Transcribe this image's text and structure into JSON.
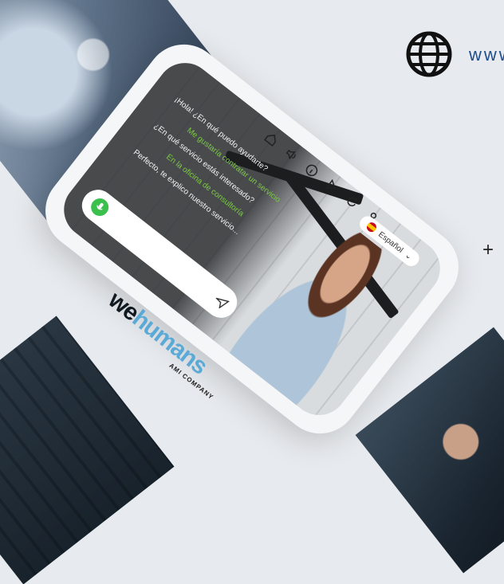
{
  "header": {
    "url": "www"
  },
  "chat": {
    "messages": [
      {
        "role": "bot",
        "text": "¡Hola! ¿En qué puedo ayudarte?"
      },
      {
        "role": "user",
        "text": "Me gustaría contratar un servicio"
      },
      {
        "role": "bot",
        "text": "¿En qué servicio estás interesado?"
      },
      {
        "role": "user",
        "text": "En la oficina de consultoría"
      },
      {
        "role": "bot",
        "text": "Perfecto, te explico nuestro servicio..."
      }
    ]
  },
  "language": {
    "selected": "Español"
  },
  "brand": {
    "logo_prefix": "we",
    "logo_suffix": "humans",
    "tagline": "AMI COMPANY"
  },
  "controls": {
    "close_symbol": "+"
  },
  "icons": [
    "home-icon",
    "volume-icon",
    "info-icon",
    "play-icon",
    "restart-icon",
    "user-icon",
    "mic-icon",
    "send-icon",
    "globe-icon"
  ],
  "colors": {
    "accent_green": "#7ac943",
    "url_blue": "#1f4d8c",
    "logo_blue": "#5aa9d6"
  }
}
